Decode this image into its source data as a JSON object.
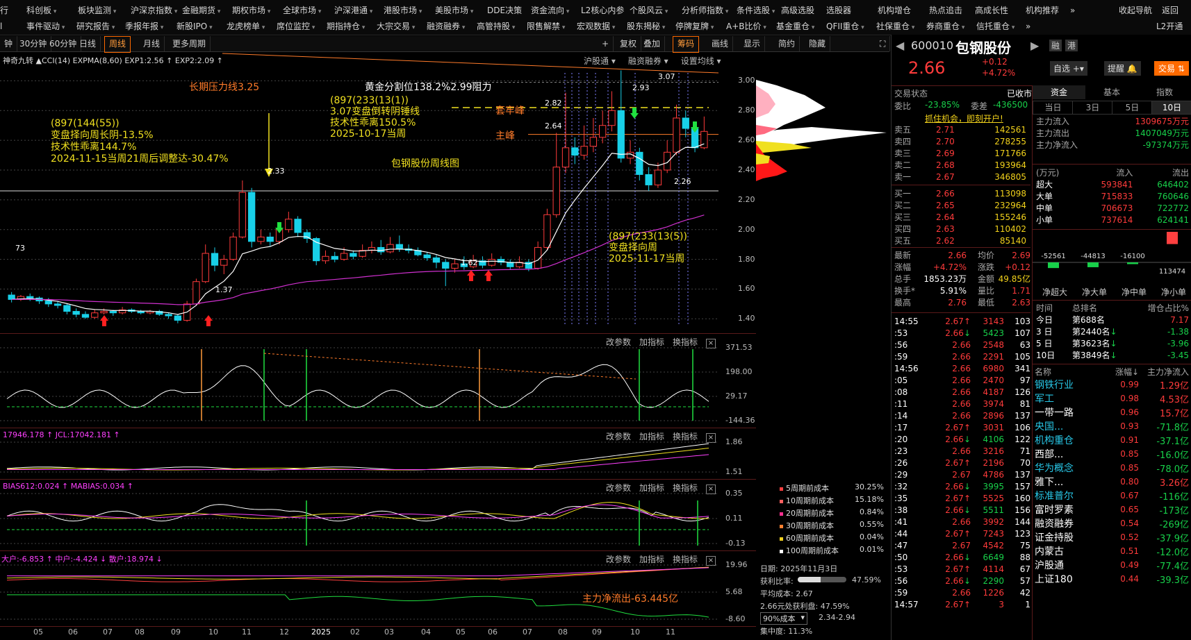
{
  "nav": {
    "row1": [
      "行",
      "科创板",
      "板块监测",
      "沪深京指数",
      "金融期货",
      "期权市场",
      "全球市场",
      "沪深港通",
      "港股市场",
      "美股市场",
      "DDE决策",
      "资金流向",
      "L2核心内参",
      "个股风云",
      "分析师指数",
      "条件选股",
      "高级选股",
      "选股器",
      "机构增仓",
      "热点追击",
      "高成长性",
      "机构推荐",
      "»",
      "收起导航",
      "返回"
    ],
    "row2": [
      "l",
      "事件驱动",
      "研究报告",
      "季报年报",
      "新股IPO",
      "龙虎榜单",
      "席位监控",
      "期指持仓",
      "大宗交易",
      "融资融券",
      "高管持股",
      "限售解禁",
      "宏观数据",
      "股东揭秘",
      "停牌复牌",
      "A+B比价",
      "基金重仓",
      "QFII重仓",
      "社保重仓",
      "券商重仓",
      "信托重仓",
      "»",
      "L2开通"
    ]
  },
  "toolbar": {
    "periods": [
      "钟",
      "30分钟",
      "60分钟",
      "日线",
      "周线",
      "月线",
      "更多周期"
    ],
    "tools": [
      "+",
      "复权",
      "叠加",
      "筹码",
      "画线",
      "显示",
      "简约",
      "隐藏"
    ],
    "active_period": "周线",
    "right_links": [
      "沪股通",
      "融资融券",
      "设置均线"
    ]
  },
  "main_chart": {
    "indicator_line": "神奇九转  ▲CCI(14)  EXPMA(8,60)  EXP1:2.56  ↑  EXP2:2.09  ↑",
    "price_axis": [
      "3.00",
      "2.80",
      "2.60",
      "2.40",
      "2.20",
      "2.00",
      "1.80",
      "1.60",
      "1.40"
    ],
    "annotations": {
      "long_pressure": "长期压力线3.25",
      "golden": "黄金分割位138.2%2.99阻力",
      "left_block": [
        "(897(144(55))",
        "变盘择向周长阴-13.5%",
        "技术性乖离144.7%",
        "2024-11-15当周21周后调整达-30.47%"
      ],
      "mid_block": [
        "(897(233(13(1))",
        "3.07变盘倒转阴锤线",
        "技术性乖离150.5%",
        "2025-10-17当周"
      ],
      "bottom_block": [
        "(897(233(13(5))",
        "变盘择向周",
        "2025-11-17当周"
      ],
      "title": "包钢股份周线图",
      "trap_peak": "套牢峰",
      "main_peak": "主峰",
      "p307": "3.07",
      "p293": "2.93",
      "p282": "2.82",
      "p264": "2.64",
      "p233": "2.33",
      "p226": "2.26",
      "p162": "1.62",
      "p137": "1.37",
      "p173": "73"
    },
    "candles": [
      {
        "o": 1.56,
        "c": 1.53,
        "h": 1.58,
        "l": 1.51
      },
      {
        "o": 1.53,
        "c": 1.55,
        "h": 1.56,
        "l": 1.52
      },
      {
        "o": 1.55,
        "c": 1.54,
        "h": 1.57,
        "l": 1.52
      },
      {
        "o": 1.54,
        "c": 1.52,
        "h": 1.55,
        "l": 1.5
      },
      {
        "o": 1.52,
        "c": 1.5,
        "h": 1.54,
        "l": 1.48
      },
      {
        "o": 1.5,
        "c": 1.49,
        "h": 1.52,
        "l": 1.47
      },
      {
        "o": 1.49,
        "c": 1.45,
        "h": 1.5,
        "l": 1.43
      },
      {
        "o": 1.45,
        "c": 1.43,
        "h": 1.47,
        "l": 1.41
      },
      {
        "o": 1.43,
        "c": 1.41,
        "h": 1.45,
        "l": 1.4
      },
      {
        "o": 1.41,
        "c": 1.44,
        "h": 1.46,
        "l": 1.4
      },
      {
        "o": 1.44,
        "c": 1.45,
        "h": 1.47,
        "l": 1.43
      },
      {
        "o": 1.45,
        "c": 1.44,
        "h": 1.46,
        "l": 1.42
      },
      {
        "o": 1.44,
        "c": 1.46,
        "h": 1.48,
        "l": 1.43
      },
      {
        "o": 1.46,
        "c": 1.45,
        "h": 1.47,
        "l": 1.44
      },
      {
        "o": 1.45,
        "c": 1.44,
        "h": 1.46,
        "l": 1.43
      },
      {
        "o": 1.44,
        "c": 1.45,
        "h": 1.46,
        "l": 1.43
      },
      {
        "o": 1.45,
        "c": 1.43,
        "h": 1.46,
        "l": 1.42
      },
      {
        "o": 1.43,
        "c": 1.42,
        "h": 1.44,
        "l": 1.4
      },
      {
        "o": 1.42,
        "c": 1.39,
        "h": 1.43,
        "l": 1.37
      },
      {
        "o": 1.39,
        "c": 1.5,
        "h": 1.52,
        "l": 1.38
      },
      {
        "o": 1.5,
        "c": 1.65,
        "h": 1.67,
        "l": 1.49
      },
      {
        "o": 1.65,
        "c": 1.84,
        "h": 1.9,
        "l": 1.64
      },
      {
        "o": 1.84,
        "c": 1.76,
        "h": 1.88,
        "l": 1.72
      },
      {
        "o": 1.76,
        "c": 1.8,
        "h": 1.83,
        "l": 1.7
      },
      {
        "o": 1.8,
        "c": 1.95,
        "h": 1.98,
        "l": 1.79
      },
      {
        "o": 1.95,
        "c": 2.25,
        "h": 2.33,
        "l": 1.94
      },
      {
        "o": 2.25,
        "c": 1.92,
        "h": 2.28,
        "l": 1.88
      },
      {
        "o": 1.92,
        "c": 1.95,
        "h": 2.0,
        "l": 1.9
      },
      {
        "o": 1.95,
        "c": 1.92,
        "h": 1.98,
        "l": 1.89
      },
      {
        "o": 1.92,
        "c": 2.0,
        "h": 2.05,
        "l": 1.9
      },
      {
        "o": 2.0,
        "c": 2.07,
        "h": 2.12,
        "l": 1.98
      },
      {
        "o": 2.07,
        "c": 1.98,
        "h": 2.09,
        "l": 1.95
      },
      {
        "o": 1.98,
        "c": 1.94,
        "h": 2.0,
        "l": 1.91
      },
      {
        "o": 1.94,
        "c": 1.79,
        "h": 1.95,
        "l": 1.76
      },
      {
        "o": 1.79,
        "c": 1.82,
        "h": 1.86,
        "l": 1.77
      },
      {
        "o": 1.82,
        "c": 1.8,
        "h": 1.85,
        "l": 1.78
      },
      {
        "o": 1.8,
        "c": 1.84,
        "h": 1.88,
        "l": 1.79
      },
      {
        "o": 1.84,
        "c": 1.82,
        "h": 1.86,
        "l": 1.8
      },
      {
        "o": 1.82,
        "c": 1.86,
        "h": 1.9,
        "l": 1.81
      },
      {
        "o": 1.86,
        "c": 1.88,
        "h": 1.92,
        "l": 1.84
      },
      {
        "o": 1.88,
        "c": 1.85,
        "h": 1.93,
        "l": 1.83
      },
      {
        "o": 1.85,
        "c": 1.9,
        "h": 1.95,
        "l": 1.84
      },
      {
        "o": 1.9,
        "c": 1.87,
        "h": 1.96,
        "l": 1.85
      },
      {
        "o": 1.87,
        "c": 1.86,
        "h": 1.9,
        "l": 1.84
      },
      {
        "o": 1.86,
        "c": 1.83,
        "h": 1.88,
        "l": 1.82
      },
      {
        "o": 1.83,
        "c": 1.81,
        "h": 1.85,
        "l": 1.79
      },
      {
        "o": 1.81,
        "c": 1.78,
        "h": 1.83,
        "l": 1.74
      },
      {
        "o": 1.78,
        "c": 1.74,
        "h": 1.8,
        "l": 1.62
      },
      {
        "o": 1.74,
        "c": 1.77,
        "h": 1.8,
        "l": 1.71
      },
      {
        "o": 1.77,
        "c": 1.75,
        "h": 1.82,
        "l": 1.73
      },
      {
        "o": 1.75,
        "c": 1.79,
        "h": 1.83,
        "l": 1.74
      },
      {
        "o": 1.79,
        "c": 1.76,
        "h": 1.82,
        "l": 1.74
      },
      {
        "o": 1.76,
        "c": 1.8,
        "h": 1.84,
        "l": 1.75
      },
      {
        "o": 1.8,
        "c": 1.78,
        "h": 1.82,
        "l": 1.76
      },
      {
        "o": 1.78,
        "c": 1.75,
        "h": 1.8,
        "l": 1.73
      },
      {
        "o": 1.75,
        "c": 1.78,
        "h": 1.82,
        "l": 1.74
      },
      {
        "o": 1.78,
        "c": 1.74,
        "h": 1.8,
        "l": 1.72
      },
      {
        "o": 1.74,
        "c": 1.88,
        "h": 1.92,
        "l": 1.73
      },
      {
        "o": 1.88,
        "c": 2.1,
        "h": 2.14,
        "l": 1.86
      },
      {
        "o": 2.1,
        "c": 2.42,
        "h": 2.65,
        "l": 2.08
      },
      {
        "o": 2.42,
        "c": 2.55,
        "h": 2.92,
        "l": 2.38
      },
      {
        "o": 2.55,
        "c": 2.5,
        "h": 2.62,
        "l": 2.44
      },
      {
        "o": 2.5,
        "c": 2.56,
        "h": 2.7,
        "l": 2.47
      },
      {
        "o": 2.56,
        "c": 2.62,
        "h": 2.75,
        "l": 2.52
      },
      {
        "o": 2.62,
        "c": 2.7,
        "h": 2.8,
        "l": 2.58
      },
      {
        "o": 2.7,
        "c": 2.8,
        "h": 2.93,
        "l": 2.66
      },
      {
        "o": 2.8,
        "c": 2.48,
        "h": 3.07,
        "l": 2.45
      },
      {
        "o": 2.48,
        "c": 2.52,
        "h": 2.6,
        "l": 2.44
      },
      {
        "o": 2.52,
        "c": 2.37,
        "h": 2.55,
        "l": 2.33
      },
      {
        "o": 2.37,
        "c": 2.3,
        "h": 2.42,
        "l": 2.26
      },
      {
        "o": 2.3,
        "c": 2.4,
        "h": 2.45,
        "l": 2.28
      },
      {
        "o": 2.4,
        "c": 2.52,
        "h": 2.6,
        "l": 2.38
      },
      {
        "o": 2.52,
        "c": 2.75,
        "h": 2.84,
        "l": 2.5
      },
      {
        "o": 2.75,
        "c": 2.68,
        "h": 2.8,
        "l": 2.62
      },
      {
        "o": 2.68,
        "c": 2.55,
        "h": 2.72,
        "l": 2.52
      },
      {
        "o": 2.55,
        "c": 2.66,
        "h": 2.76,
        "l": 2.54
      }
    ],
    "month_labels": [
      "05",
      "06",
      "07",
      "08",
      "09",
      "10",
      "11",
      "12",
      "2025",
      "02",
      "03",
      "04",
      "05",
      "06",
      "07",
      "08",
      "09",
      "10",
      "11"
    ]
  },
  "sub1": {
    "toolbar": [
      "改参数",
      "加指标",
      "换指标"
    ],
    "axis": [
      "371.53",
      "198.00",
      "29.17",
      "-144.36"
    ]
  },
  "sub2": {
    "label": "17946.178  ↑  JCL:17042.181  ↑",
    "toolbar": [
      "改参数",
      "加指标",
      "换指标"
    ],
    "axis": [
      "1.86",
      "1.51"
    ]
  },
  "sub3": {
    "label": "BIAS612:0.024  ↑  MABIAS:0.034  ↑",
    "toolbar": [
      "改参数",
      "加指标",
      "换指标"
    ],
    "axis": [
      "0.35",
      "0.11",
      "-0.13"
    ]
  },
  "sub4": {
    "label": "大户:-6.853  ↑  中户:-4.424  ↓  散户:18.974  ↓",
    "toolbar": [
      "改参数",
      "加指标",
      "换指标"
    ],
    "axis": [
      "19.96",
      "5.68",
      "-8.60"
    ],
    "annotation": "主力净流出-63.445亿"
  },
  "cost_legend": {
    "items": [
      {
        "label": "5周期前成本",
        "value": "30.25%",
        "color": "#ff4040"
      },
      {
        "label": "10周期前成本",
        "value": "15.18%",
        "color": "#ff6060"
      },
      {
        "label": "20周期前成本",
        "value": "0.84%",
        "color": "#ff3090"
      },
      {
        "label": "30周期前成本",
        "value": "0.55%",
        "color": "#ff8030"
      },
      {
        "label": "60周期前成本",
        "value": "0.04%",
        "color": "#f0d020"
      },
      {
        "label": "100周期前成本",
        "value": "0.01%",
        "color": "#ffffff"
      }
    ],
    "date": "日期: 2025年11月3日",
    "profit_ratio_label": "获利比率:",
    "profit_ratio": "47.59%",
    "profit_fill": 0.4759,
    "avg_cost": "平均成本: 2.67",
    "profit_at": "2.66元处获利盘: 47.59%",
    "cost90": "90%成本",
    "cost90_range": "2.34-2.94",
    "concentration": "集中度: 11.3%"
  },
  "stock": {
    "code": "600010",
    "name": "包钢股份",
    "price": "2.66",
    "change": "+0.12",
    "change_pct": "+4.72%",
    "badges": [
      "融",
      "港"
    ],
    "buttons": {
      "watch": "自选",
      "alert": "提醒",
      "trade": "交易"
    },
    "status_label": "交易状态",
    "status": "已收市",
    "weibi_label": "委比",
    "weibi": "-23.85%",
    "weicha_label": "委差",
    "weicha": "-436500",
    "promo": "抓住机会，即刻开户!",
    "asks": [
      {
        "label": "卖五",
        "price": "2.71",
        "vol": "142561"
      },
      {
        "label": "卖四",
        "price": "2.70",
        "vol": "278255"
      },
      {
        "label": "卖三",
        "price": "2.69",
        "vol": "171766"
      },
      {
        "label": "卖二",
        "price": "2.68",
        "vol": "193964"
      },
      {
        "label": "卖一",
        "price": "2.67",
        "vol": "346805"
      }
    ],
    "bids": [
      {
        "label": "买一",
        "price": "2.66",
        "vol": "113098"
      },
      {
        "label": "买二",
        "price": "2.65",
        "vol": "232964"
      },
      {
        "label": "买三",
        "price": "2.64",
        "vol": "155246"
      },
      {
        "label": "买四",
        "price": "2.63",
        "vol": "110402"
      },
      {
        "label": "买五",
        "price": "2.62",
        "vol": "85140"
      }
    ],
    "quote": [
      {
        "l1": "最新",
        "v1": "2.66",
        "l2": "均价",
        "v2": "2.69"
      },
      {
        "l1": "涨幅",
        "v1": "+4.72%",
        "l2": "涨跌",
        "v2": "+0.12"
      },
      {
        "l1": "总手",
        "v1": "1853.23万",
        "l2": "金额",
        "v2": "49.85亿"
      },
      {
        "l1": "换手*",
        "v1": "5.91%",
        "l2": "量比",
        "v2": "1.71"
      },
      {
        "l1": "最高",
        "v1": "2.76",
        "l2": "最低",
        "v2": "2.63"
      }
    ],
    "ticks": [
      {
        "t": "14:55",
        "p": "2.67",
        "a": "↑",
        "v": "3143",
        "n": "103"
      },
      {
        "t": ":53",
        "p": "2.66",
        "a": "↓",
        "v": "5423",
        "n": "107"
      },
      {
        "t": ":56",
        "p": "2.66",
        "a": "",
        "v": "2548",
        "n": "63"
      },
      {
        "t": ":59",
        "p": "2.66",
        "a": "",
        "v": "2291",
        "n": "105"
      },
      {
        "t": "14:56",
        "p": "2.66",
        "a": "",
        "v": "6980",
        "n": "341"
      },
      {
        "t": ":05",
        "p": "2.66",
        "a": "",
        "v": "2470",
        "n": "97"
      },
      {
        "t": ":08",
        "p": "2.66",
        "a": "",
        "v": "4187",
        "n": "126"
      },
      {
        "t": ":11",
        "p": "2.66",
        "a": "",
        "v": "3974",
        "n": "81"
      },
      {
        "t": ":14",
        "p": "2.66",
        "a": "",
        "v": "2896",
        "n": "137"
      },
      {
        "t": ":17",
        "p": "2.67",
        "a": "↑",
        "v": "3031",
        "n": "106"
      },
      {
        "t": ":20",
        "p": "2.66",
        "a": "↓",
        "v": "4106",
        "n": "122"
      },
      {
        "t": ":23",
        "p": "2.66",
        "a": "",
        "v": "3216",
        "n": "71"
      },
      {
        "t": ":26",
        "p": "2.67",
        "a": "↑",
        "v": "2196",
        "n": "70"
      },
      {
        "t": ":29",
        "p": "2.67",
        "a": "",
        "v": "4786",
        "n": "137"
      },
      {
        "t": ":32",
        "p": "2.66",
        "a": "↓",
        "v": "3995",
        "n": "157"
      },
      {
        "t": ":35",
        "p": "2.67",
        "a": "↑",
        "v": "5525",
        "n": "160"
      },
      {
        "t": ":38",
        "p": "2.66",
        "a": "↓",
        "v": "5511",
        "n": "156"
      },
      {
        "t": ":41",
        "p": "2.66",
        "a": "",
        "v": "3992",
        "n": "144"
      },
      {
        "t": ":44",
        "p": "2.67",
        "a": "↑",
        "v": "7243",
        "n": "123"
      },
      {
        "t": ":47",
        "p": "2.67",
        "a": "",
        "v": "4542",
        "n": "75"
      },
      {
        "t": ":50",
        "p": "2.66",
        "a": "↓",
        "v": "6649",
        "n": "88"
      },
      {
        "t": ":53",
        "p": "2.67",
        "a": "↑",
        "v": "4114",
        "n": "67"
      },
      {
        "t": ":56",
        "p": "2.66",
        "a": "↓",
        "v": "2290",
        "n": "57"
      },
      {
        "t": ":59",
        "p": "2.66",
        "a": "",
        "v": "1226",
        "n": "42"
      },
      {
        "t": "14:57",
        "p": "2.67",
        "a": "↑",
        "v": "3",
        "n": "1"
      }
    ],
    "fund_tabs": [
      "资金",
      "基本",
      "指数"
    ],
    "day_tabs": [
      "当日",
      "3日",
      "5日",
      "10日"
    ],
    "flows": [
      {
        "label": "主力流入",
        "value": "1309675万元",
        "cls": "red"
      },
      {
        "label": "主力流出",
        "value": "1407049万元",
        "cls": "grn"
      },
      {
        "label": "主力净流入",
        "value": "-97374万元",
        "cls": "grn"
      }
    ],
    "flow_head": {
      "unit": "(万元)",
      "in": "流入",
      "out": "流出"
    },
    "flow_table": [
      {
        "label": "超大",
        "in": "593841",
        "out": "646402"
      },
      {
        "label": "大单",
        "in": "715833",
        "out": "760646"
      },
      {
        "label": "中单",
        "in": "706673",
        "out": "722772"
      },
      {
        "label": "小单",
        "in": "737614",
        "out": "624141"
      }
    ],
    "net_bars": [
      {
        "label": "净超大",
        "value": -52561,
        "text": "-52561"
      },
      {
        "label": "净大单",
        "value": -44813,
        "text": "-44813"
      },
      {
        "label": "净中单",
        "value": -16100,
        "text": "-16100"
      },
      {
        "label": "净小单",
        "value": 113474,
        "text": "113474"
      }
    ],
    "rank_head": {
      "c1": "时间",
      "c2": "总排名",
      "c3": "增仓占比%"
    },
    "ranks": [
      {
        "t": "今日",
        "r": "第688名",
        "a": "",
        "v": "7.17",
        "cls": "red"
      },
      {
        "t": "3 日",
        "r": "第2440名",
        "a": "↓",
        "v": "-1.38",
        "cls": "grn"
      },
      {
        "t": "5 日",
        "r": "第3623名",
        "a": "↓",
        "v": "-3.96",
        "cls": "grn"
      },
      {
        "t": "10日",
        "r": "第3849名",
        "a": "↓",
        "v": "-3.45",
        "cls": "grn"
      }
    ],
    "sector_head": {
      "c1": "名称",
      "c2": "涨幅↓",
      "c3": "主力净流入"
    },
    "sectors": [
      {
        "n": "钢铁行业",
        "p": "0.99",
        "f": "1.29亿",
        "fc": "red",
        "nc": "cyan"
      },
      {
        "n": "军工",
        "p": "0.98",
        "f": "4.53亿",
        "fc": "red",
        "nc": "cyan"
      },
      {
        "n": "一带一路",
        "p": "0.96",
        "f": "15.7亿",
        "fc": "red",
        "nc": "wht"
      },
      {
        "n": "央国...",
        "p": "0.93",
        "f": "-71.8亿",
        "fc": "grn",
        "nc": "cyan"
      },
      {
        "n": "机构重仓",
        "p": "0.91",
        "f": "-37.1亿",
        "fc": "grn",
        "nc": "cyan"
      },
      {
        "n": "西部...",
        "p": "0.85",
        "f": "-16.0亿",
        "fc": "grn",
        "nc": "wht"
      },
      {
        "n": "华为概念",
        "p": "0.85",
        "f": "-78.0亿",
        "fc": "grn",
        "nc": "cyan"
      },
      {
        "n": "雅下...",
        "p": "0.80",
        "f": "3.26亿",
        "fc": "red",
        "nc": "wht"
      },
      {
        "n": "标准普尔",
        "p": "0.67",
        "f": "-116亿",
        "fc": "grn",
        "nc": "cyan"
      },
      {
        "n": "富时罗素",
        "p": "0.65",
        "f": "-173亿",
        "fc": "grn",
        "nc": "wht"
      },
      {
        "n": "融资融券",
        "p": "0.54",
        "f": "-269亿",
        "fc": "grn",
        "nc": "wht"
      },
      {
        "n": "证金持股",
        "p": "0.52",
        "f": "-37.9亿",
        "fc": "grn",
        "nc": "wht"
      },
      {
        "n": "内蒙古",
        "p": "0.51",
        "f": "-12.0亿",
        "fc": "grn",
        "nc": "wht"
      },
      {
        "n": "沪股通",
        "p": "0.49",
        "f": "-77.4亿",
        "fc": "grn",
        "nc": "wht"
      },
      {
        "n": "上证180",
        "p": "0.44",
        "f": "-39.3亿",
        "fc": "grn",
        "nc": "wht"
      }
    ]
  },
  "colors": {
    "up": "#ff3b3b",
    "down": "#18d0e8",
    "ema1": "#ffffff",
    "ema2": "#d030d0",
    "accent": "#ff6a00",
    "yellow": "#f2d21b"
  }
}
